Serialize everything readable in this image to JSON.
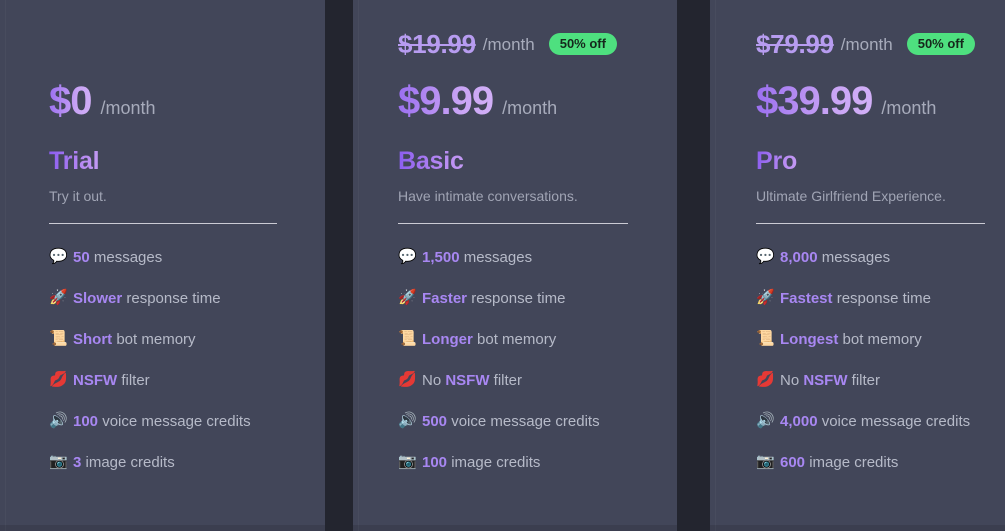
{
  "theme": {
    "page_background": "#23252f",
    "card_background": "#424659",
    "accent_purple": "#a887f2",
    "price_gradient_from": "#9a6ef0",
    "price_gradient_to": "#d2b0f7",
    "badge_green": "#4ee07f",
    "badge_text": "#16281c",
    "muted_text": "#a7abbb",
    "feature_text": "#b6bac8",
    "divider": "#e9e9ef"
  },
  "per_month_label": "/month",
  "plans": [
    {
      "id": "trial",
      "name": "Trial",
      "description": "Try it out.",
      "old_price": null,
      "discount_badge": null,
      "price": "$0",
      "features": [
        {
          "icon": "speech-balloon-icon",
          "glyph": "💬",
          "highlight": "50",
          "rest": " messages",
          "prefix": ""
        },
        {
          "icon": "rocket-icon",
          "glyph": "🚀",
          "highlight": "Slower",
          "rest": " response time",
          "prefix": ""
        },
        {
          "icon": "scroll-icon",
          "glyph": "📜",
          "highlight": "Short",
          "rest": " bot memory",
          "prefix": ""
        },
        {
          "icon": "kiss-mark-icon",
          "glyph": "💋",
          "highlight": "NSFW",
          "rest": " filter",
          "prefix": ""
        },
        {
          "icon": "speaker-icon",
          "glyph": "🔊",
          "highlight": "100",
          "rest": " voice message credits",
          "prefix": ""
        },
        {
          "icon": "camera-icon",
          "glyph": "📷",
          "highlight": "3",
          "rest": " image credits",
          "prefix": ""
        }
      ]
    },
    {
      "id": "basic",
      "name": "Basic",
      "description": "Have intimate conversations.",
      "old_price": "$19.99",
      "discount_badge": "50% off",
      "price": "$9.99",
      "features": [
        {
          "icon": "speech-balloon-icon",
          "glyph": "💬",
          "highlight": "1,500",
          "rest": " messages",
          "prefix": ""
        },
        {
          "icon": "rocket-icon",
          "glyph": "🚀",
          "highlight": "Faster",
          "rest": " response time",
          "prefix": ""
        },
        {
          "icon": "scroll-icon",
          "glyph": "📜",
          "highlight": "Longer",
          "rest": " bot memory",
          "prefix": ""
        },
        {
          "icon": "kiss-mark-icon",
          "glyph": "💋",
          "highlight": "NSFW",
          "rest": " filter",
          "prefix": "No "
        },
        {
          "icon": "speaker-icon",
          "glyph": "🔊",
          "highlight": "500",
          "rest": " voice message credits",
          "prefix": ""
        },
        {
          "icon": "camera-icon",
          "glyph": "📷",
          "highlight": "100",
          "rest": " image credits",
          "prefix": ""
        }
      ]
    },
    {
      "id": "pro",
      "name": "Pro",
      "description": "Ultimate Girlfriend Experience.",
      "old_price": "$79.99",
      "discount_badge": "50% off",
      "price": "$39.99",
      "features": [
        {
          "icon": "speech-balloon-icon",
          "glyph": "💬",
          "highlight": "8,000",
          "rest": " messages",
          "prefix": ""
        },
        {
          "icon": "rocket-icon",
          "glyph": "🚀",
          "highlight": "Fastest",
          "rest": " response time",
          "prefix": ""
        },
        {
          "icon": "scroll-icon",
          "glyph": "📜",
          "highlight": "Longest",
          "rest": " bot memory",
          "prefix": ""
        },
        {
          "icon": "kiss-mark-icon",
          "glyph": "💋",
          "highlight": "NSFW",
          "rest": " filter",
          "prefix": "No "
        },
        {
          "icon": "speaker-icon",
          "glyph": "🔊",
          "highlight": "4,000",
          "rest": " voice message credits",
          "prefix": ""
        },
        {
          "icon": "camera-icon",
          "glyph": "📷",
          "highlight": "600",
          "rest": " image credits",
          "prefix": ""
        }
      ]
    }
  ]
}
